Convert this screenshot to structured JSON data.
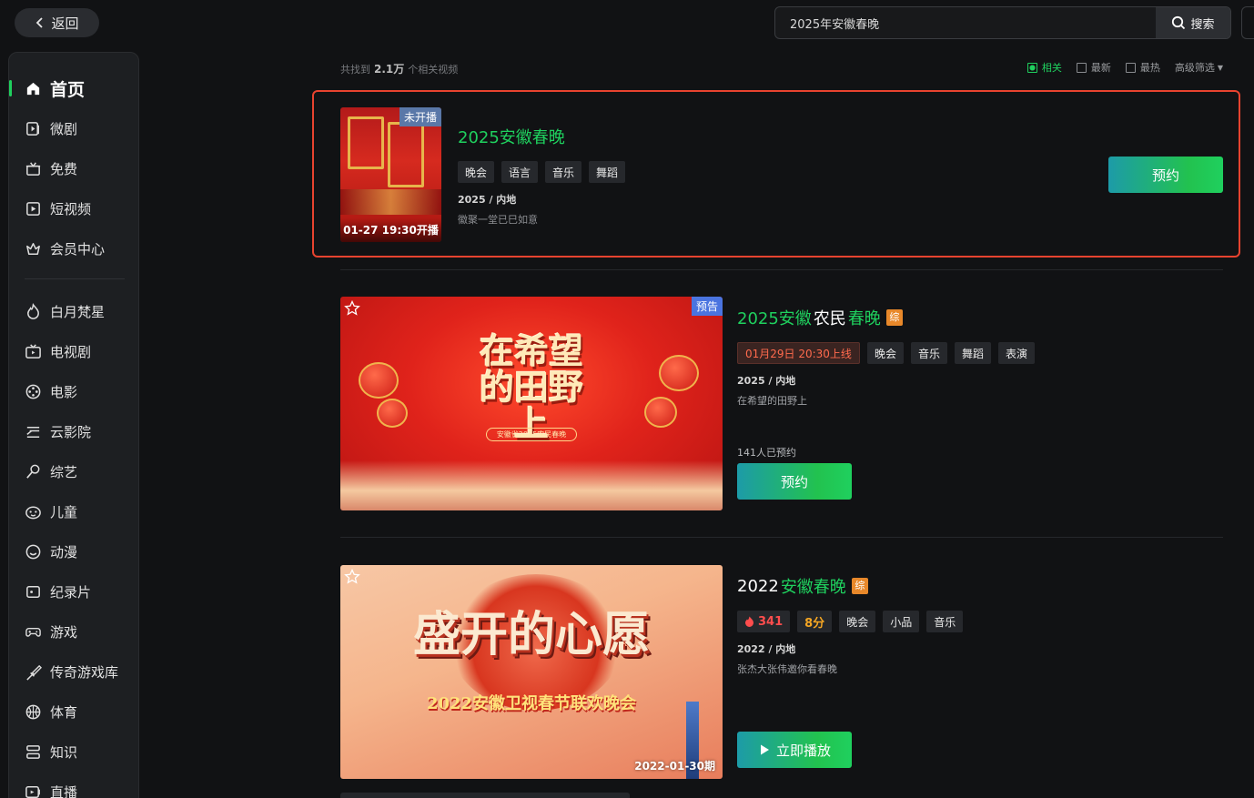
{
  "header": {
    "back_label": "返回",
    "search_value": "2025年安徽春晚",
    "search_button": "搜索"
  },
  "sidebar": {
    "items": [
      {
        "label": "首页",
        "icon": "home-icon",
        "active": true
      },
      {
        "label": "微剧",
        "icon": "micro-drama-icon"
      },
      {
        "label": "免费",
        "icon": "free-icon"
      },
      {
        "label": "短视频",
        "icon": "short-video-icon"
      },
      {
        "label": "会员中心",
        "icon": "crown-icon"
      },
      {
        "label": "白月梵星",
        "icon": "flame-icon"
      },
      {
        "label": "电视剧",
        "icon": "tv-icon"
      },
      {
        "label": "电影",
        "icon": "film-reel-icon"
      },
      {
        "label": "云影院",
        "icon": "cloud-cinema-icon"
      },
      {
        "label": "综艺",
        "icon": "microphone-icon"
      },
      {
        "label": "儿童",
        "icon": "child-face-icon"
      },
      {
        "label": "动漫",
        "icon": "anime-icon"
      },
      {
        "label": "纪录片",
        "icon": "documentary-icon"
      },
      {
        "label": "游戏",
        "icon": "gamepad-icon"
      },
      {
        "label": "传奇游戏库",
        "icon": "sword-icon"
      },
      {
        "label": "体育",
        "icon": "basketball-icon"
      },
      {
        "label": "知识",
        "icon": "knowledge-icon"
      },
      {
        "label": "直播",
        "icon": "live-icon"
      }
    ]
  },
  "results_header": {
    "prefix": "共找到",
    "count": "2.1万",
    "suffix": "个相关视频",
    "filters": [
      {
        "label": "相关",
        "checked": true
      },
      {
        "label": "最新",
        "checked": false
      },
      {
        "label": "最热",
        "checked": false
      }
    ],
    "advanced": "高级筛选"
  },
  "results": [
    {
      "title": "2025安徽春晚",
      "corner_badge": "未开播",
      "bottom_badge": "01-27 19:30开播",
      "tags": [
        "晚会",
        "语言",
        "音乐",
        "舞蹈"
      ],
      "meta": "2025 / 内地",
      "desc": "徽聚一堂已巳如意",
      "button": "预约"
    },
    {
      "title_parts": [
        {
          "text": "2025安徽",
          "color": "green"
        },
        {
          "text": "农民",
          "color": "white"
        },
        {
          "text": "春晚",
          "color": "green"
        }
      ],
      "type_badge": "综",
      "corner_badge": "预告",
      "poster_text": "在希望的田野上",
      "poster_sub": "安徽省2025农民春晚",
      "date_tag": "01月29日 20:30上线",
      "tags": [
        "晚会",
        "音乐",
        "舞蹈",
        "表演"
      ],
      "meta": "2025 / 内地",
      "desc": "在希望的田野上",
      "reserved": "141人已预约",
      "button": "预约"
    },
    {
      "title_parts": [
        {
          "text": "2022",
          "color": "white"
        },
        {
          "text": "安徽春晚",
          "color": "green"
        }
      ],
      "type_badge": "综",
      "poster_text": "盛开的心愿",
      "poster_sub": "2022安徽卫视春节联欢晚会",
      "period": "2022-01-30期",
      "hot": "341",
      "score": "8分",
      "tags": [
        "晚会",
        "小品",
        "音乐"
      ],
      "meta": "2022 / 内地",
      "desc": "张杰大张伟邀你看春晚",
      "button": "立即播放"
    }
  ],
  "colors": {
    "accent_green": "#1fd05e",
    "highlight_border": "#e8432f",
    "background": "#111214"
  }
}
